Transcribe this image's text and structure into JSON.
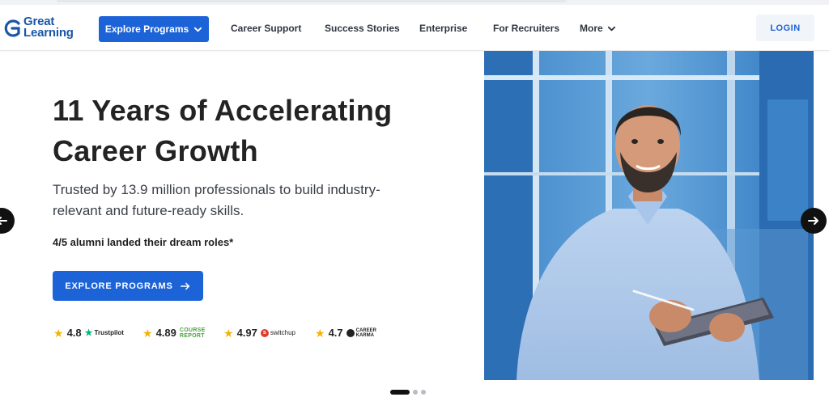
{
  "header": {
    "logo": {
      "line1": "Great",
      "line2": "Learning"
    },
    "explore_programs_label": "Explore Programs",
    "nav": [
      {
        "label": "Career Support"
      },
      {
        "label": "Success Stories"
      },
      {
        "label": "Enterprise"
      },
      {
        "label": "For Recruiters"
      },
      {
        "label": "More"
      }
    ],
    "login_label": "LOGIN"
  },
  "hero": {
    "title_line1": "11 Years of Accelerating",
    "title_line2": "Career Growth",
    "subtitle_line1": "Trusted by 13.9 million professionals to build industry-",
    "subtitle_line2": "relevant and future-ready skills.",
    "stat": "4/5 alumni landed their dream roles*",
    "cta_label": "EXPLORE PROGRAMS"
  },
  "ratings": [
    {
      "value": "4.8",
      "brand": "Trustpilot",
      "icon": "star-icon"
    },
    {
      "value": "4.89",
      "brand_line1": "COURSE",
      "brand_line2": "REPORT",
      "icon": "star-icon"
    },
    {
      "value": "4.97",
      "brand": "switchup",
      "icon": "star-icon"
    },
    {
      "value": "4.7",
      "brand_line1": "CAREER",
      "brand_line2": "KARMA",
      "icon": "star-icon"
    }
  ],
  "carousel": {
    "slide_count": 3,
    "active_index": 0
  },
  "icons": {
    "explore_chevron": "chevron-down-icon",
    "more_chevron": "chevron-down-icon",
    "cta_arrow": "arrow-right-icon",
    "prev": "arrow-left-icon",
    "next": "arrow-right-icon"
  },
  "colors": {
    "brand_blue": "#1c63d8",
    "logo_blue": "#1a57a6",
    "star": "#f5b301",
    "text_dark": "#232323"
  }
}
